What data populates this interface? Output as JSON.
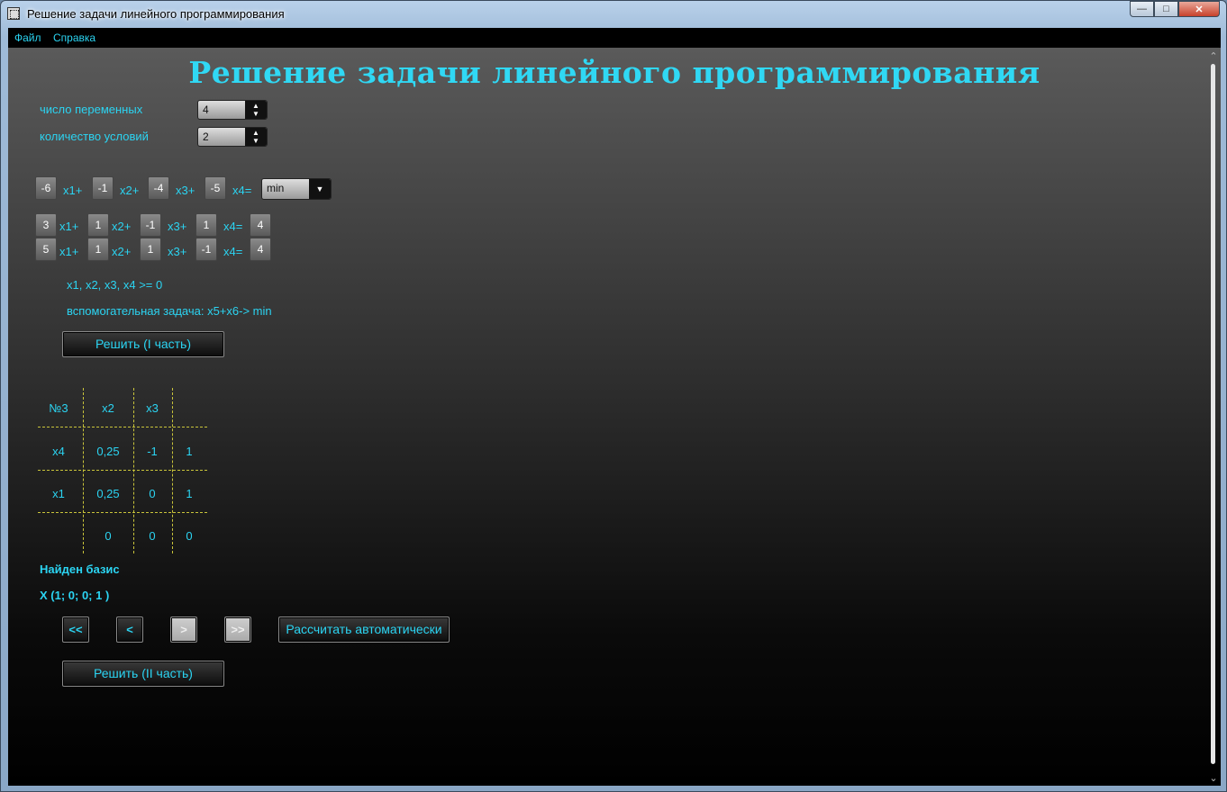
{
  "window": {
    "title": "Решение задачи линейного программирования"
  },
  "menu": {
    "items": [
      "Файл",
      "Справка"
    ]
  },
  "page": {
    "title": "Решение задачи линейного программирования"
  },
  "settings": {
    "vars_label": "число переменных",
    "vars_value": "4",
    "cond_label": "количество условий",
    "cond_value": "2"
  },
  "objective": {
    "coefs": [
      "-6",
      "-1",
      "-4",
      "-5"
    ],
    "labels": [
      "x1+",
      "x2+",
      "x3+",
      "x4="
    ],
    "goal": "min"
  },
  "constraints": [
    {
      "coefs": [
        "3",
        "1",
        "-1",
        "1"
      ],
      "labels": [
        "x1+",
        "x2+",
        "x3+",
        "x4="
      ],
      "rhs": "4"
    },
    {
      "coefs": [
        "5",
        "1",
        "1",
        "-1"
      ],
      "labels": [
        "x1+",
        "x2+",
        "x3+",
        "x4="
      ],
      "rhs": "4"
    }
  ],
  "nonneg": "x1, x2, x3, x4 >= 0",
  "aux": "вспомогательная задача: x5+x6-> min",
  "solve1_label": "Решить (I часть)",
  "table": {
    "header": [
      "№3",
      "x2",
      "x3",
      ""
    ],
    "rows": [
      [
        "x4",
        "0,25",
        "-1",
        "1"
      ],
      [
        "x1",
        "0,25",
        "0",
        "1"
      ],
      [
        "",
        "0",
        "0",
        "0"
      ]
    ]
  },
  "result": {
    "status": "Найден базис",
    "x": "X (1; 0; 0; 1 )"
  },
  "nav": {
    "first": "<<",
    "prev": "<",
    "next": ">",
    "last": ">>",
    "auto": "Рассчитать автоматически"
  },
  "solve2_label": "Решить (II часть)",
  "colors": {
    "accent": "#2bd4f2",
    "grid": "#c9c43a"
  }
}
